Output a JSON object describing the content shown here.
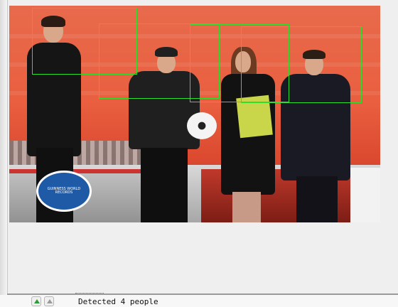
{
  "viewer": {
    "image_description_name": "detection-result-image",
    "detections_count": 4,
    "box_color": "#2ee02e"
  },
  "photo": {
    "badge_text": "GUINNESS WORLD RECORDS"
  },
  "status": {
    "message": "Detected 4 people"
  },
  "toolbar": {
    "buttons": [
      {
        "icon": "up-arrow-green-icon"
      },
      {
        "icon": "up-arrow-grey-icon"
      }
    ]
  }
}
